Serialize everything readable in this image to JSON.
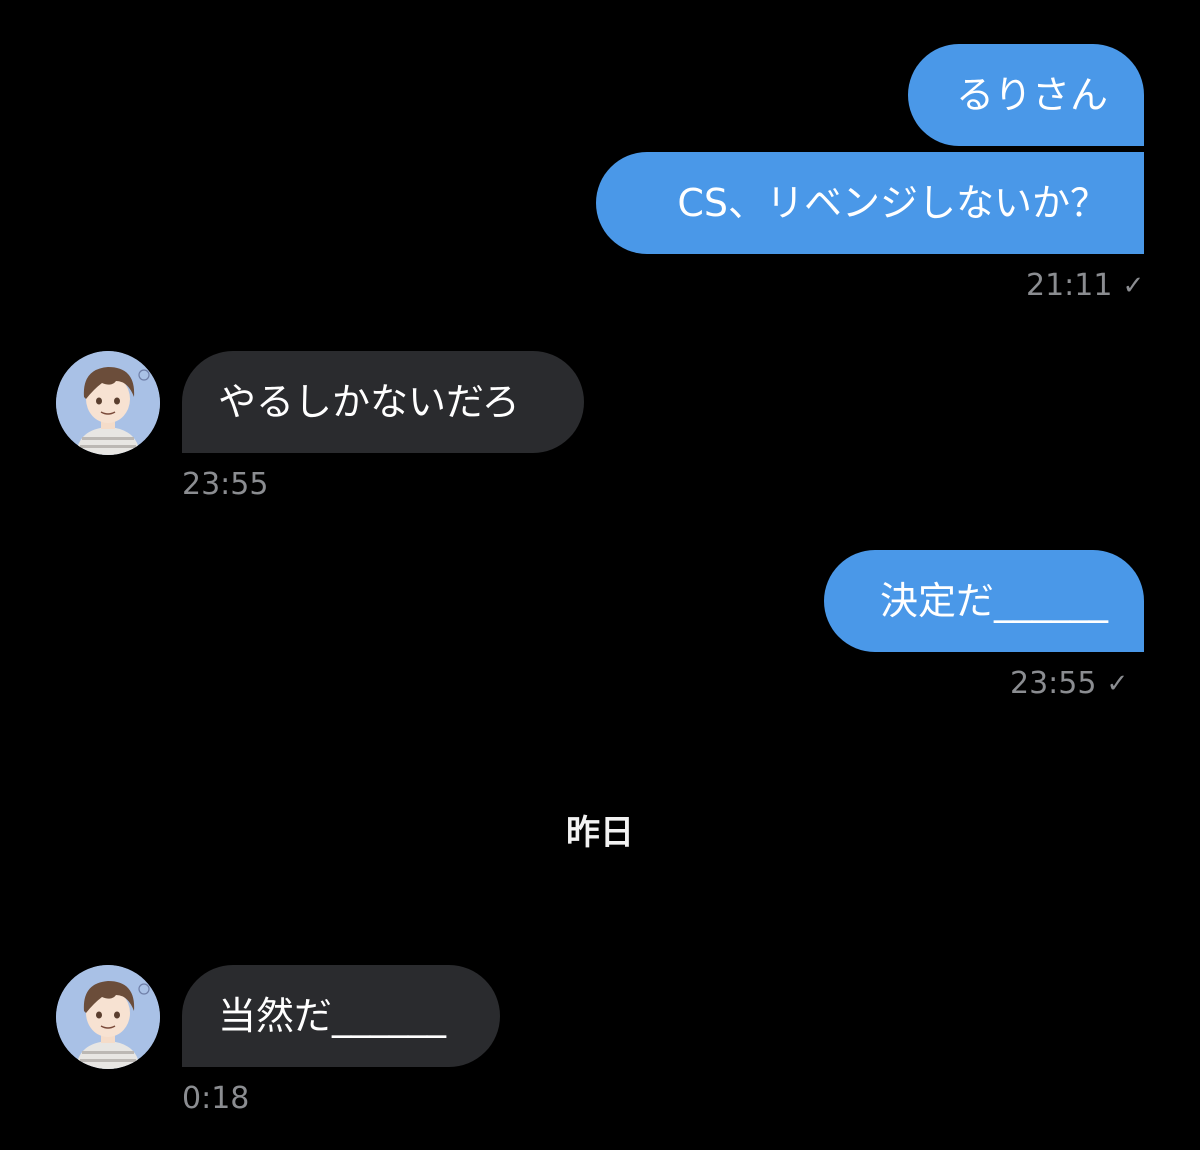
{
  "conversation": {
    "messages": [
      {
        "direction": "outgoing",
        "text": "るりさん"
      },
      {
        "direction": "outgoing",
        "text": "CS、リベンジしないか？",
        "time": "21:11",
        "status_icon": "check-icon"
      },
      {
        "direction": "incoming",
        "text": "やるしかないだろ",
        "time": "23:55",
        "avatar_icon": "contact-avatar"
      },
      {
        "direction": "outgoing",
        "text": "決定だ______",
        "time": "23:55",
        "status_icon": "check-icon"
      },
      {
        "direction": "incoming",
        "text": "当然だ______",
        "time": "0:18",
        "avatar_icon": "contact-avatar"
      }
    ],
    "date_divider": "昨日",
    "check_glyph": "✓"
  },
  "colors": {
    "background": "#000000",
    "outgoing_bubble": "#4a98e8",
    "incoming_bubble": "#2a2b2e",
    "timestamp": "#8b8d91",
    "text": "#ffffff"
  }
}
